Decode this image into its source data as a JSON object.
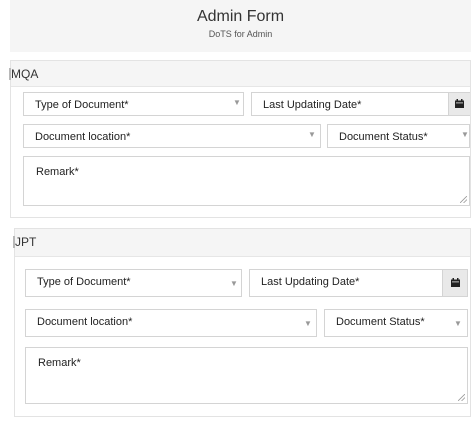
{
  "header": {
    "title": "Admin Form",
    "subtitle": "DoTS for Admin"
  },
  "sections": [
    {
      "name": "MQA",
      "fields": {
        "type_of_document": "Type of Document*",
        "last_updating_date": "Last Updating Date*",
        "document_location": "Document location*",
        "document_status": "Document Status*",
        "remark": "Remark*"
      }
    },
    {
      "name": "JPT",
      "fields": {
        "type_of_document": "Type of Document*",
        "last_updating_date": "Last Updating Date*",
        "document_location": "Document location*",
        "document_status": "Document Status*",
        "remark": "Remark*"
      }
    }
  ],
  "icons": {
    "dropdown": "chevron-down-icon",
    "date": "calendar-icon",
    "resize": "resize-grip-icon"
  },
  "colors": {
    "header_bg": "#f5f5f5",
    "border": "#d4d4d4",
    "date_button_bg": "#e9e9e9"
  }
}
